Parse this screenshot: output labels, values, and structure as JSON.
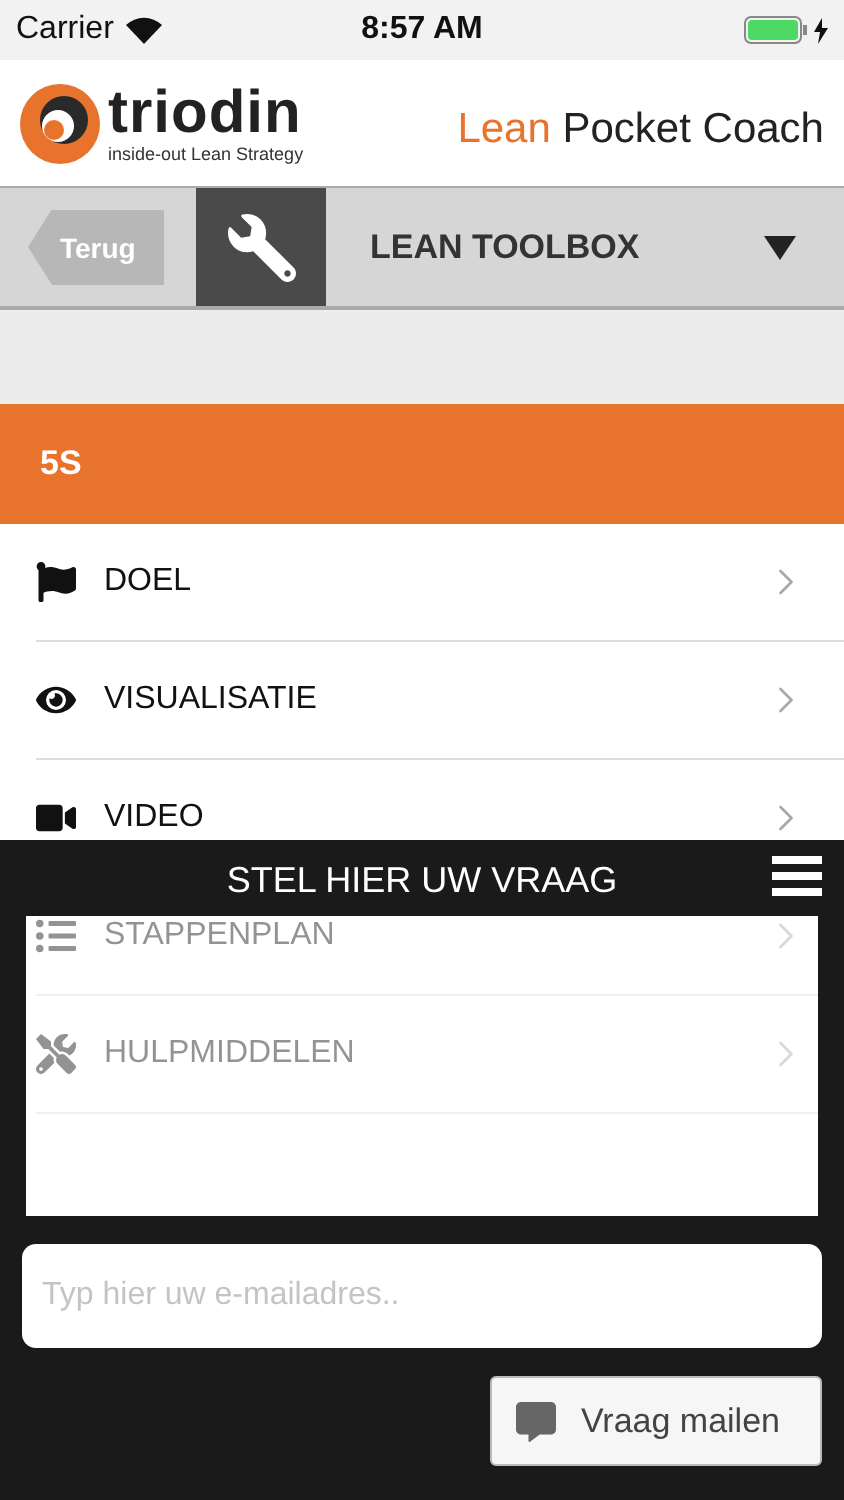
{
  "status_bar": {
    "carrier": "Carrier",
    "time": "8:57 AM"
  },
  "header": {
    "logo_name": "triodin",
    "logo_tagline": "inside-out Lean Strategy",
    "title_accent": "Lean",
    "title_rest": "Pocket Coach"
  },
  "toolbar": {
    "back": "Terug",
    "title": "LEAN TOOLBOX"
  },
  "section": {
    "title": "5S"
  },
  "items": [
    {
      "kind": "flag",
      "label": "DOEL"
    },
    {
      "kind": "eye",
      "label": "VISUALISATIE"
    },
    {
      "kind": "video",
      "label": "VIDEO"
    },
    {
      "kind": "list",
      "label": "STAPPENPLAN"
    },
    {
      "kind": "tools",
      "label": "HULPMIDDELEN"
    }
  ],
  "question_panel": {
    "title": "STEL HIER UW VRAAG",
    "email_placeholder": "Typ hier uw e-mailadres..",
    "send": "Vraag mailen"
  }
}
